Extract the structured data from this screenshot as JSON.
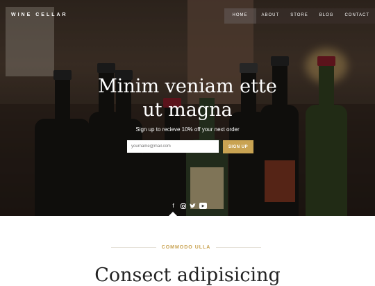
{
  "brand": "WINE CELLAR",
  "nav": [
    "HOME",
    "ABOUT",
    "STORE",
    "BLOG",
    "CONTACT"
  ],
  "hero": {
    "headline_line1": "Minim veniam ette",
    "headline_line2": "ut magna",
    "subtext": "Sign up to recieve 10% off your next order",
    "email_placeholder": "yourname@mail.com",
    "signup_label": "SIGN UP"
  },
  "social": [
    "facebook-icon",
    "instagram-icon",
    "twitter-icon",
    "youtube-icon"
  ],
  "section": {
    "eyebrow": "COMMODO ULLA",
    "heading": "Consect adipisicing"
  },
  "colors": {
    "accent": "#c9a352",
    "nav_bg": "#3c322d"
  }
}
